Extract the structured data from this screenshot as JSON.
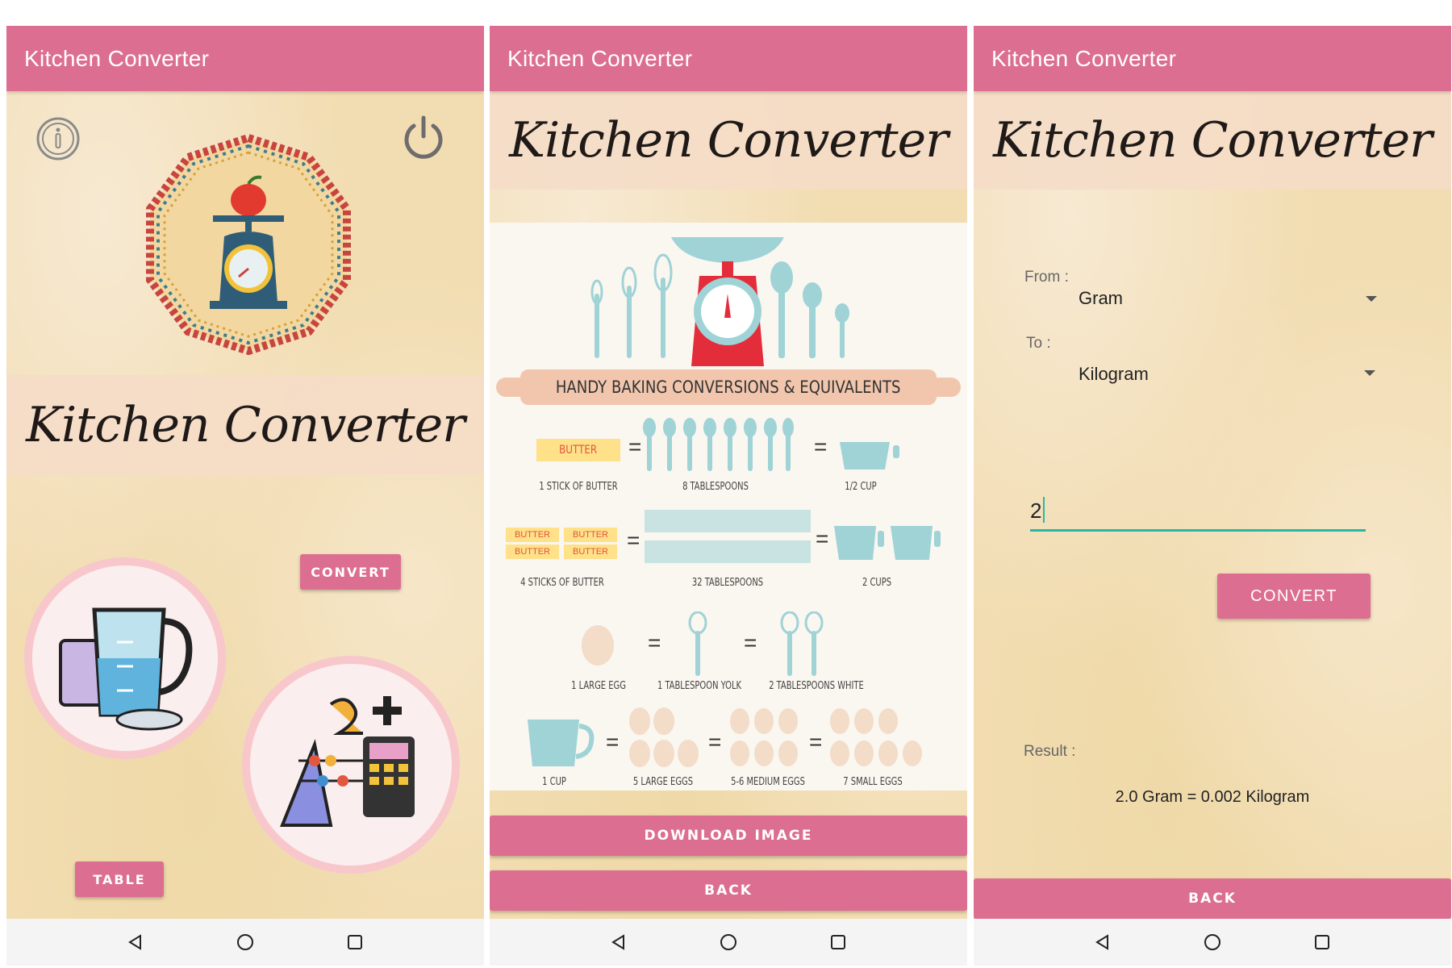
{
  "app_title": "Kitchen Converter",
  "script_title": "Kitchen Converter",
  "home": {
    "convert_label": "CONVERT",
    "table_label": "TABLE"
  },
  "table_screen": {
    "banner": "HANDY BAKING CONVERSIONS & EQUIVALENTS",
    "butter_word": "BUTTER",
    "rows": [
      {
        "items": [
          "1 STICK OF BUTTER",
          "8 TABLESPOONS",
          "1/2 CUP"
        ]
      },
      {
        "items": [
          "4 STICKS OF BUTTER",
          "32 TABLESPOONS",
          "2 CUPS"
        ]
      },
      {
        "items": [
          "1 LARGE EGG",
          "1 TABLESPOON YOLK",
          "2 TABLESPOONS WHITE"
        ]
      },
      {
        "items": [
          "1 CUP",
          "5 LARGE EGGS",
          "5-6 MEDIUM EGGS",
          "7 SMALL EGGS"
        ]
      }
    ],
    "equals": "=",
    "download_label": "DOWNLOAD IMAGE",
    "back_label": "BACK"
  },
  "convert_screen": {
    "from_label": "From :",
    "from_value": "Gram",
    "to_label": "To :",
    "to_value": "Kilogram",
    "input_value": "2",
    "convert_label": "CONVERT",
    "result_label": "Result :",
    "result_text": "2.0 Gram = 0.002 Kilogram",
    "back_label": "BACK"
  },
  "colors": {
    "primary": "#dc6f91",
    "accent": "#26b8a6",
    "background": "#f2ddb2"
  }
}
